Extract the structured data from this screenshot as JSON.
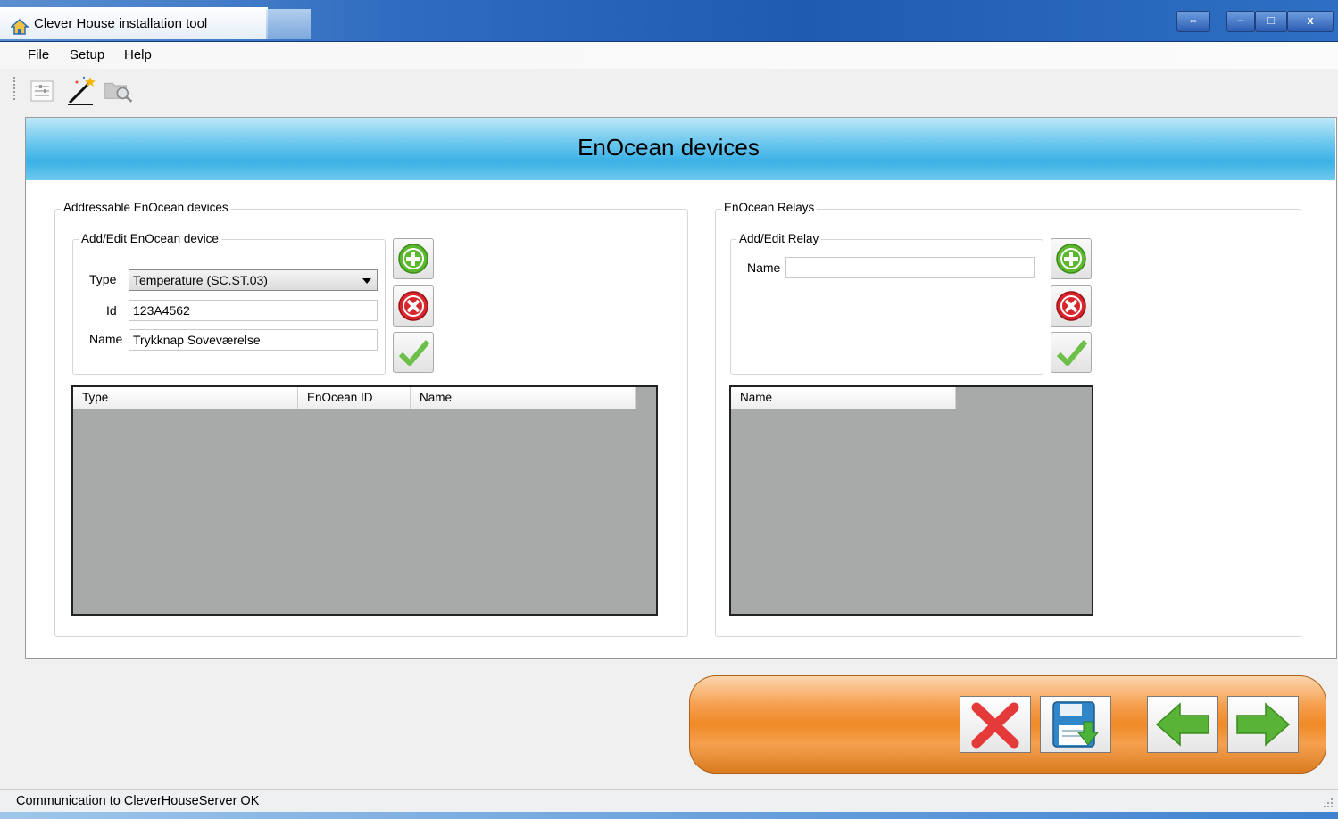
{
  "window": {
    "title": "Clever House installation tool",
    "controls": {
      "restore_label": "⇔",
      "minimize_label": "–",
      "maximize_label": "□",
      "close_label": "x"
    }
  },
  "menu": {
    "file": "File",
    "setup": "Setup",
    "help": "Help"
  },
  "toolbar": {
    "icons": [
      "list-settings-icon",
      "magic-wand-icon",
      "folder-search-icon"
    ]
  },
  "page": {
    "title": "EnOcean devices"
  },
  "devices": {
    "group_label": "Addressable EnOcean devices",
    "edit_group_label": "Add/Edit EnOcean device",
    "type_label": "Type",
    "type_value": "Temperature (SC.ST.03)",
    "id_label": "Id",
    "id_value": "123A4562",
    "name_label": "Name",
    "name_value": "Trykknap Soveværelse",
    "table_columns": [
      "Type",
      "EnOcean ID",
      "Name"
    ],
    "rows": []
  },
  "relays": {
    "group_label": "EnOcean Relays",
    "edit_group_label": "Add/Edit Relay",
    "name_label": "Name",
    "name_value": "",
    "table_columns": [
      "Name"
    ],
    "rows": []
  },
  "status": {
    "text": "Communication to CleverHouseServer OK"
  },
  "colors": {
    "accent_blue": "#3ab1e5",
    "orange": "#f08a25",
    "green": "#5cb82e",
    "red": "#d9262c"
  }
}
